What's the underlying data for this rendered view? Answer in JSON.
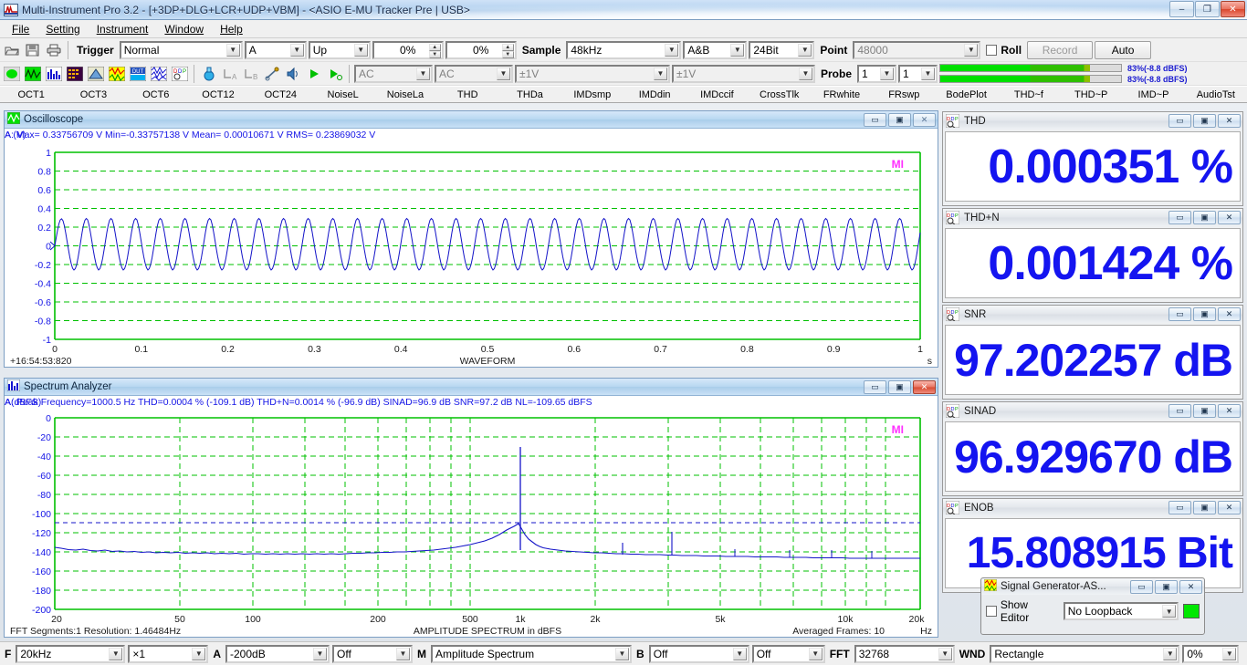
{
  "window": {
    "title": "Multi-Instrument Pro 3.2   -   [+3DP+DLG+LCR+UDP+VBM]   -   <ASIO E-MU Tracker Pre | USB>",
    "minimize": "–",
    "maximize": "❐",
    "close": "✕"
  },
  "menu": [
    "File",
    "Setting",
    "Instrument",
    "Window",
    "Help"
  ],
  "toolbar1": {
    "icons": [
      "open-folder-icon",
      "save-disk-icon",
      "print-icon"
    ],
    "trigger_label": "Trigger",
    "trigger_mode": "Normal",
    "trigger_channel": "A",
    "trigger_slope": "Up",
    "trigger_level": "0%",
    "trigger_delay": "0%",
    "sample_label": "Sample",
    "sample_rate": "48kHz",
    "channels": "A&B",
    "bit_depth": "24Bit",
    "point_label": "Point",
    "point_value": "48000",
    "roll_label": "Roll",
    "record_label": "Record",
    "auto_label": "Auto"
  },
  "toolbar2": {
    "coupling_a": "AC",
    "coupling_b": "AC",
    "range_a": "±1V",
    "range_b": "±1V",
    "probe_label": "Probe",
    "probe_a": "1",
    "probe_b": "1",
    "level_a_text": "83%(-8.8 dBFS)",
    "level_b_text": "83%(-8.8 dBFS)",
    "level_a_pct": 83,
    "level_b_pct": 83
  },
  "tabs": [
    "OCT1",
    "OCT3",
    "OCT6",
    "OCT12",
    "OCT24",
    "NoiseL",
    "NoiseLa",
    "THD",
    "THDa",
    "IMDsmp",
    "IMDdin",
    "IMDccif",
    "CrossTlk",
    "FRwhite",
    "FRswp",
    "BodePlot",
    "THD~f",
    "THD~P",
    "IMD~P",
    "AudioTst"
  ],
  "oscilloscope": {
    "title": "Oscilloscope",
    "info": "A: Max= 0.33756709 V  Min=-0.33757138 V  Mean= 0.00010671 V  RMS= 0.23869032 V",
    "ylabel": "A (V)",
    "xcaption": "WAVEFORM",
    "xunit": "s",
    "timestamp": "+16:54:53:820",
    "watermark": "MI"
  },
  "spectrum": {
    "title": "Spectrum Analyzer",
    "info": "A: Peak Frequency=1000.5 Hz  THD=0.0004 % (-109.1 dB)  THD+N=0.0014 % (-96.9 dB)  SINAD=96.9 dB  SNR=97.2 dB  NL=-109.65 dBFS",
    "ylabel": "A(dBFS)",
    "xcaption": "AMPLITUDE SPECTRUM in dBFS",
    "xunit": "Hz",
    "footer_left": "FFT Segments:1   Resolution: 1.46484Hz",
    "footer_right": "Averaged Frames: 10",
    "watermark": "MI"
  },
  "meters": [
    {
      "name": "THD",
      "value": "0.000351 %"
    },
    {
      "name": "THD+N",
      "value": "0.001424 %"
    },
    {
      "name": "SNR",
      "value": "97.202257 dB"
    },
    {
      "name": "SINAD",
      "value": "96.929670 dB"
    },
    {
      "name": "ENOB",
      "value": "15.808915 Bit"
    }
  ],
  "siggen": {
    "title": "Signal Generator-AS...",
    "show_editor": "Show Editor",
    "loopback": "No Loopback"
  },
  "bottombar": {
    "f_label": "F",
    "f_value": "20kHz",
    "mult_value": "×1",
    "a_label": "A",
    "a_value": "-200dB",
    "a_mode": "Off",
    "m_label": "M",
    "m_value": "Amplitude Spectrum",
    "b_label": "B",
    "b_value": "Off",
    "b_mode": "Off",
    "fft_label": "FFT",
    "fft_value": "32768",
    "wnd_label": "WND",
    "wnd_value": "Rectangle",
    "wnd_overlap": "0%"
  },
  "chart_data": [
    {
      "type": "line",
      "id": "oscilloscope-waveform",
      "title": "WAVEFORM",
      "xlabel": "s",
      "ylabel": "A (V)",
      "xlim": [
        0,
        1
      ],
      "ylim": [
        -1,
        1
      ],
      "xticks": [
        "0",
        "0.1",
        "0.2",
        "0.3",
        "0.4",
        "0.5",
        "0.6",
        "0.7",
        "0.8",
        "0.9",
        "1"
      ],
      "yticks": [
        "1",
        "0.8",
        "0.6",
        "0.4",
        "0.2",
        "0",
        "-0.2",
        "-0.4",
        "-0.6",
        "-0.8",
        "-1"
      ],
      "grid": true,
      "grid_color": "#00c000",
      "trace_color": "#0000cc",
      "series": [
        {
          "name": "A",
          "waveform": "sine",
          "frequency_hz": 1000.5,
          "amplitude_v": 0.3376,
          "rms_v": 0.23869032,
          "mean_v": 0.00010671,
          "max_v": 0.33756709,
          "min_v": -0.33757138
        }
      ]
    },
    {
      "type": "line",
      "id": "amplitude-spectrum",
      "title": "AMPLITUDE SPECTRUM in dBFS",
      "xlabel": "Hz",
      "ylabel": "A(dBFS)",
      "xscale": "log",
      "xlim": [
        20,
        20000
      ],
      "ylim": [
        -200,
        0
      ],
      "xticks": [
        "20",
        "50",
        "100",
        "200",
        "500",
        "1k",
        "2k",
        "5k",
        "10k",
        "20k"
      ],
      "yticks": [
        "0",
        "-20",
        "-40",
        "-60",
        "-80",
        "-100",
        "-120",
        "-140",
        "-160",
        "-180",
        "-200"
      ],
      "grid": true,
      "grid_color": "#00c000",
      "trace_color": "#0000cc",
      "noise_floor_line_dbfs": -109.65,
      "peak": {
        "frequency_hz": 1000.5,
        "level_dbfs": -9
      },
      "harmonics": [
        {
          "frequency_hz": 2000,
          "level_dbfs": -130
        },
        {
          "frequency_hz": 3000,
          "level_dbfs": -118
        }
      ],
      "noise_floor_shape_dbfs": [
        -134,
        -136,
        -138,
        -139,
        -140,
        -140,
        -141,
        -141,
        -142,
        -142,
        -143,
        -143,
        -144,
        -144,
        -145,
        -145,
        -146,
        -146,
        -147,
        -147
      ]
    }
  ]
}
